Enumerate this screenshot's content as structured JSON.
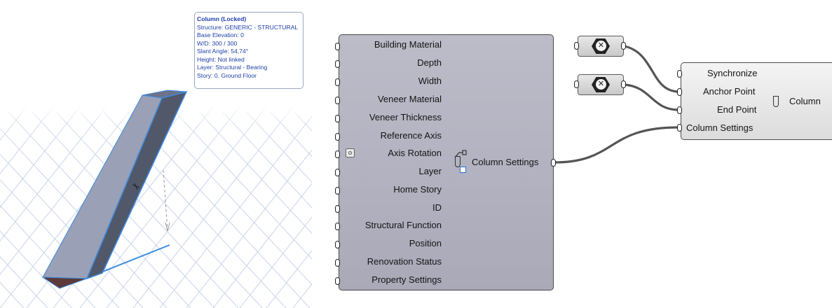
{
  "viewport": {
    "tooltip": {
      "title": "Column (Locked)",
      "lines": [
        "Structure: GENERIC - STRUCTURAL",
        "Base Elevation: 0",
        "W/D: 300 / 300",
        "Slant Angle: 54,74°",
        "Height: Not linked",
        "Layer: Structural - Bearing",
        "Story: 0. Ground Floor"
      ]
    }
  },
  "column_settings_node": {
    "inputs": [
      "Building Material",
      "Depth",
      "Width",
      "Veneer Material",
      "Veneer Thickness",
      "Reference Axis",
      "Axis Rotation",
      "Layer",
      "Home Story",
      "ID",
      "Structural Function",
      "Position",
      "Renovation Status",
      "Property Settings"
    ],
    "output": "Column Settings",
    "icon": "column-settings-icon"
  },
  "point_params": [
    {
      "icon": "x-hexagon-icon",
      "symbol": "✕"
    },
    {
      "icon": "x-hexagon-icon",
      "symbol": "✕"
    }
  ],
  "column_node": {
    "inputs": [
      "Synchronize",
      "Anchor Point",
      "End Point",
      "Column Settings"
    ],
    "output": "Column",
    "icon": "column-icon"
  },
  "colors": {
    "node_fill": "#b3b3c1",
    "wire": "#555555",
    "tooltip_text": "#1d3fa8",
    "selection_edge": "#3d8be0"
  }
}
